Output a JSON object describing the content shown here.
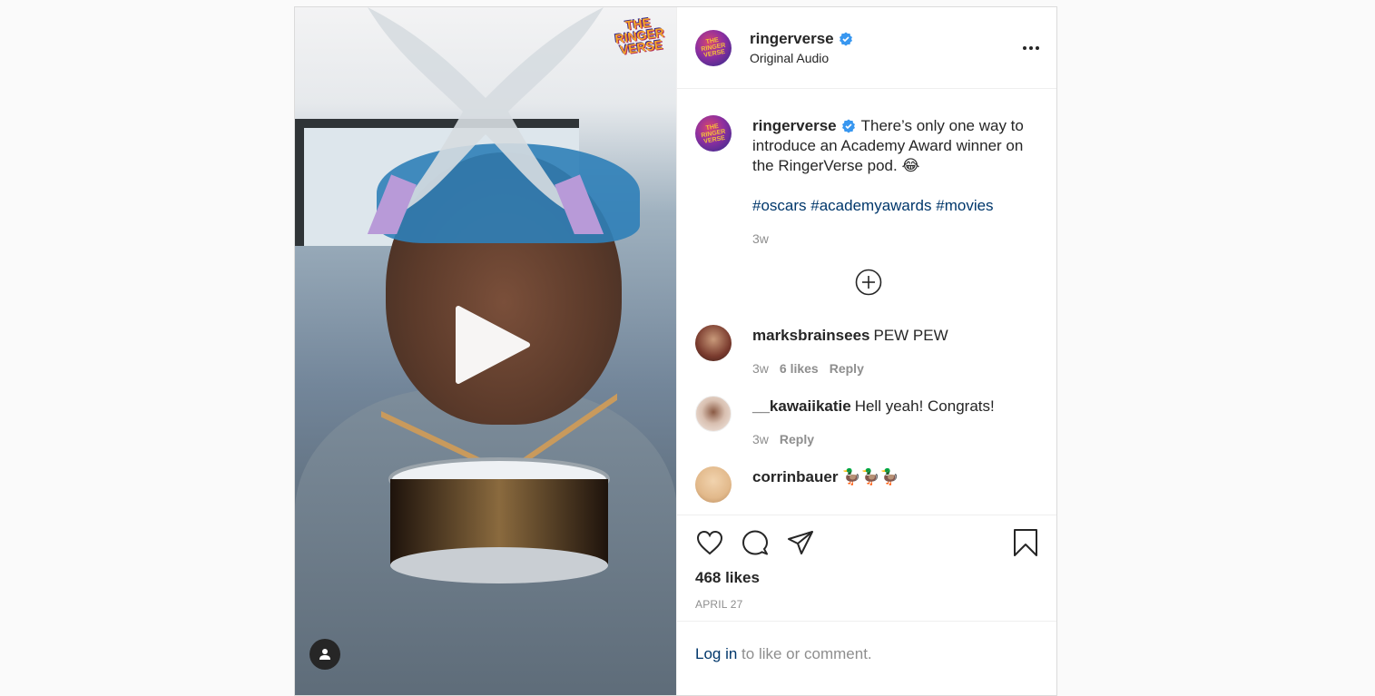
{
  "header": {
    "username": "ringerverse",
    "audio": "Original Audio",
    "avatar_text": "THE RINGER VERSE"
  },
  "media": {
    "logo_text": "THE RINGER VERSE"
  },
  "caption": {
    "username": "ringerverse",
    "text": "There’s only one way to introduce an Academy Award winner on the RingerVerse pod. 😂",
    "hashtags": [
      "#oscars",
      "#academyawards",
      "#movies"
    ],
    "age": "3w"
  },
  "comments": [
    {
      "username": "marksbrainsees",
      "text": "PEW PEW",
      "age": "3w",
      "likes": "6 likes",
      "reply": "Reply",
      "avatar_color": "#7a3b2e"
    },
    {
      "username": "__kawaiikatie",
      "text": "Hell yeah! Congrats!",
      "age": "3w",
      "likes": "",
      "reply": "Reply",
      "avatar_color": "#e9d8cc"
    },
    {
      "username": "corrinbauer",
      "text": "🦆🦆🦆",
      "age": "",
      "likes": "",
      "reply": "",
      "avatar_color": "#e2b98b"
    }
  ],
  "footer": {
    "likes": "468 likes",
    "date": "APRIL 27",
    "login_link": "Log in",
    "login_text": " to like or comment."
  }
}
